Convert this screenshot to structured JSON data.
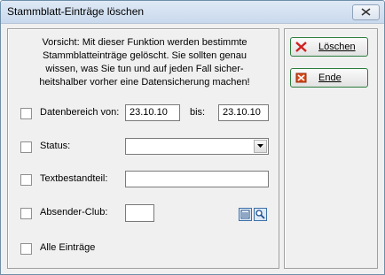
{
  "window": {
    "title": "Stammblatt-Einträge löschen"
  },
  "warning_lines": [
    "Vorsicht: Mit dieser Funktion werden bestimmte",
    "Stammblatteinträge gelöscht. Sie sollten genau",
    "wissen, was Sie tun und auf jeden Fall sicher-",
    "heitshalber vorher eine Datensicherung machen!"
  ],
  "filters": {
    "datenbereich": {
      "label": "Datenbereich von:",
      "from": "23.10.10",
      "to_label": "bis:",
      "to": "23.10.10",
      "checked": false
    },
    "status": {
      "label": "Status:",
      "value": "",
      "checked": false
    },
    "textbestandteil": {
      "label": "Textbestandteil:",
      "value": "",
      "checked": false
    },
    "absender_club": {
      "label": "Absender-Club:",
      "value": "",
      "checked": false
    },
    "alle": {
      "label": "Alle Einträge",
      "checked": false
    }
  },
  "buttons": {
    "delete": {
      "label": "Löschen",
      "icon": "red-x-icon"
    },
    "end": {
      "label": "Ende",
      "icon": "exit-icon"
    }
  },
  "colors": {
    "title_bg": "#c9d9ed",
    "button_border": "#2b7d3c",
    "delete_icon": "#d02020",
    "end_icon": "#d84a1a"
  }
}
